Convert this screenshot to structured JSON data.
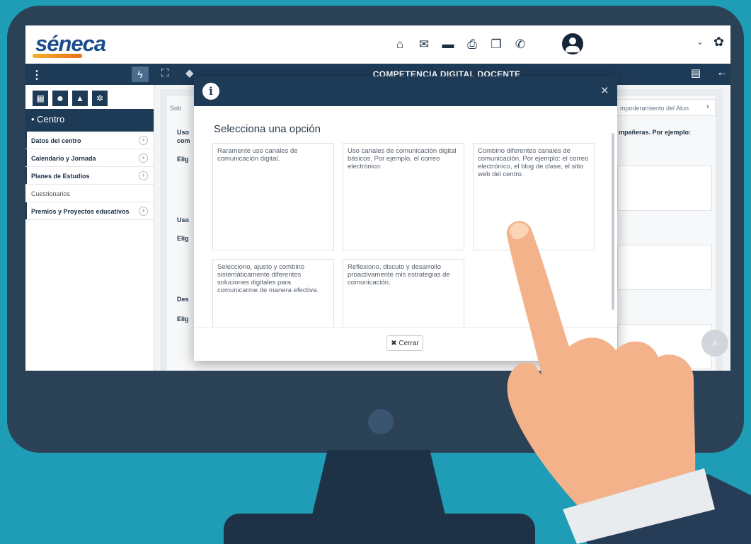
{
  "app": {
    "logo_text": "séneca",
    "module_title": "COMPETENCIA DIGITAL DOCENTE"
  },
  "topbar": {
    "icons": [
      "home-icon",
      "mail-icon",
      "folder-icon",
      "print-icon",
      "copy-icon",
      "phone-icon",
      "user-avatar-icon",
      "settings-icon"
    ],
    "user_chevron": "⌄"
  },
  "sidebar": {
    "tabs": [
      "building-icon",
      "users-icon",
      "graduation-icon",
      "cogs-icon"
    ],
    "section_label": "• Centro",
    "items": [
      {
        "label": "Datos del centro",
        "expandable": true
      },
      {
        "label": "Calendario y Jornada",
        "expandable": true
      },
      {
        "label": "Planes de Estudios",
        "expandable": true
      },
      {
        "label": "Cuestionarios",
        "expandable": false
      },
      {
        "label": "Premios y Proyectos educativos",
        "expandable": true
      }
    ]
  },
  "background": {
    "tab_left": "Sob",
    "rows": [
      {
        "label": "Uso",
        "sub": "com"
      },
      {
        "label": "Elig"
      },
      {
        "label": "Uso"
      },
      {
        "label": "Elig"
      },
      {
        "label": "Des"
      },
      {
        "label": "Elig"
      }
    ],
    "right_tab": "mpoderamiento del Alun",
    "right_text": "mpañeras. Por ejemplo:"
  },
  "modal": {
    "title": "Selecciona una opción",
    "options": [
      "Raramente uso canales de comunicación digital.",
      "Uso canales de comunicación digital básicos. Por ejemplo, el correo electrónico.",
      "Combino diferentes canales de comunicación. Por ejemplo: el correo electrónico, el blog de clase, el sitio web del centro.",
      "Selecciono, ajusto y combino sistemáticamente diferentes soluciones digitales para comunicarme de manera efectiva.",
      "Reflexiono, discuto y desarrollo proactivamente mis estrategias de comunicación."
    ],
    "close_label": "Cerrar",
    "close_glyph": "✖"
  },
  "colors": {
    "navy": "#1d3a57",
    "teal_bg": "#1f9db6",
    "monitor": "#2b4156"
  }
}
